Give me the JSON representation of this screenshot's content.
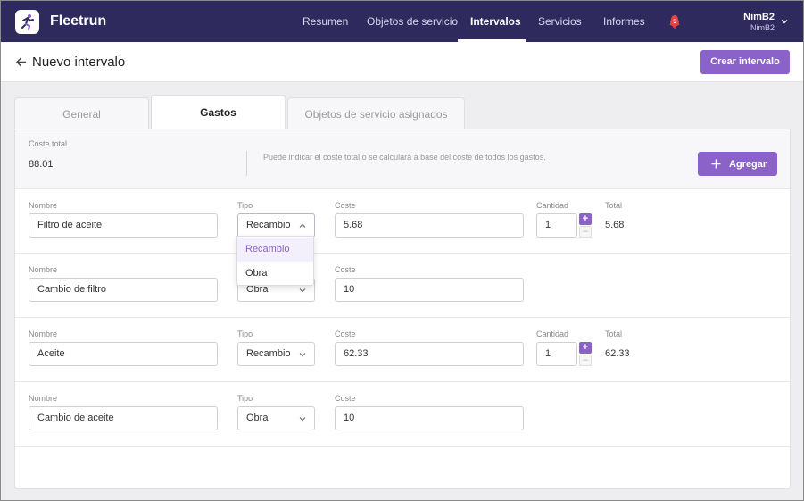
{
  "app": {
    "brand": "Fleetrun",
    "nav": [
      "Resumen",
      "Objetos de servicio",
      "Intervalos",
      "Servicios",
      "Informes"
    ],
    "active_nav": "Intervalos",
    "notifications_count": "5",
    "user": {
      "name": "NimB2",
      "account": "NimB2"
    }
  },
  "page": {
    "title": "Nuevo intervalo",
    "create_button": "Crear intervalo"
  },
  "tabs": [
    "General",
    "Gastos",
    "Objetos de servicio asignados"
  ],
  "active_tab": "Gastos",
  "summary": {
    "total_label": "Coste total",
    "total_value": "88.01",
    "hint": "Puede indicar el coste total o se calculará a base del coste de todos los gastos.",
    "add_button": "Agregar"
  },
  "labels": {
    "name": "Nombre",
    "type": "Tipo",
    "cost": "Coste",
    "quantity": "Cantidad",
    "total": "Total"
  },
  "expenses": [
    {
      "name": "Filtro de aceite",
      "type": "Recambio",
      "cost": "5.68",
      "quantity": "1",
      "total": "5.68"
    },
    {
      "name": "Cambio de filtro",
      "type": "Obra",
      "cost": "10"
    },
    {
      "name": "Aceite",
      "type": "Recambio",
      "cost": "62.33",
      "quantity": "1",
      "total": "62.33"
    },
    {
      "name": "Cambio de aceite",
      "type": "Obra",
      "cost": "10"
    }
  ],
  "type_dropdown": {
    "open_for_row": 0,
    "options": [
      "Recambio",
      "Obra"
    ],
    "selected": "Recambio"
  },
  "colors": {
    "topbar": "#2e2a5e",
    "accent": "#8b62c8",
    "badge": "#e54242"
  }
}
